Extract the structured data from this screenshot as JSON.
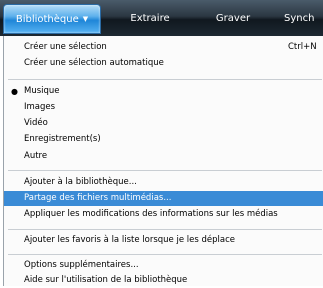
{
  "tabs": [
    {
      "label": "Bibliothèque",
      "active": true
    },
    {
      "label": "Extraire",
      "active": false
    },
    {
      "label": "Graver",
      "active": false
    },
    {
      "label": "Synch",
      "active": false
    }
  ],
  "menu": {
    "group1": [
      {
        "label": "Créer une sélection",
        "shortcut": "Ctrl+N"
      },
      {
        "label": "Créer une sélection automatique"
      }
    ],
    "group2": [
      {
        "label": "Musique",
        "checked": true
      },
      {
        "label": "Images"
      },
      {
        "label": "Vidéo"
      },
      {
        "label": "Enregistrement(s)"
      },
      {
        "label": "Autre"
      }
    ],
    "group3": [
      {
        "label": "Ajouter à la bibliothèque..."
      },
      {
        "label": "Partage des fichiers multimédias...",
        "highlighted": true
      },
      {
        "label": "Appliquer les modifications des informations sur les médias"
      }
    ],
    "group4": [
      {
        "label": "Ajouter les favoris à la liste lorsque je les déplace"
      }
    ],
    "group5": [
      {
        "label": "Options supplémentaires..."
      },
      {
        "label": "Aide sur l'utilisation de la bibliothèque"
      }
    ]
  },
  "colors": {
    "highlight": "#3a8bd6",
    "active_tab": "#1f86d8"
  }
}
